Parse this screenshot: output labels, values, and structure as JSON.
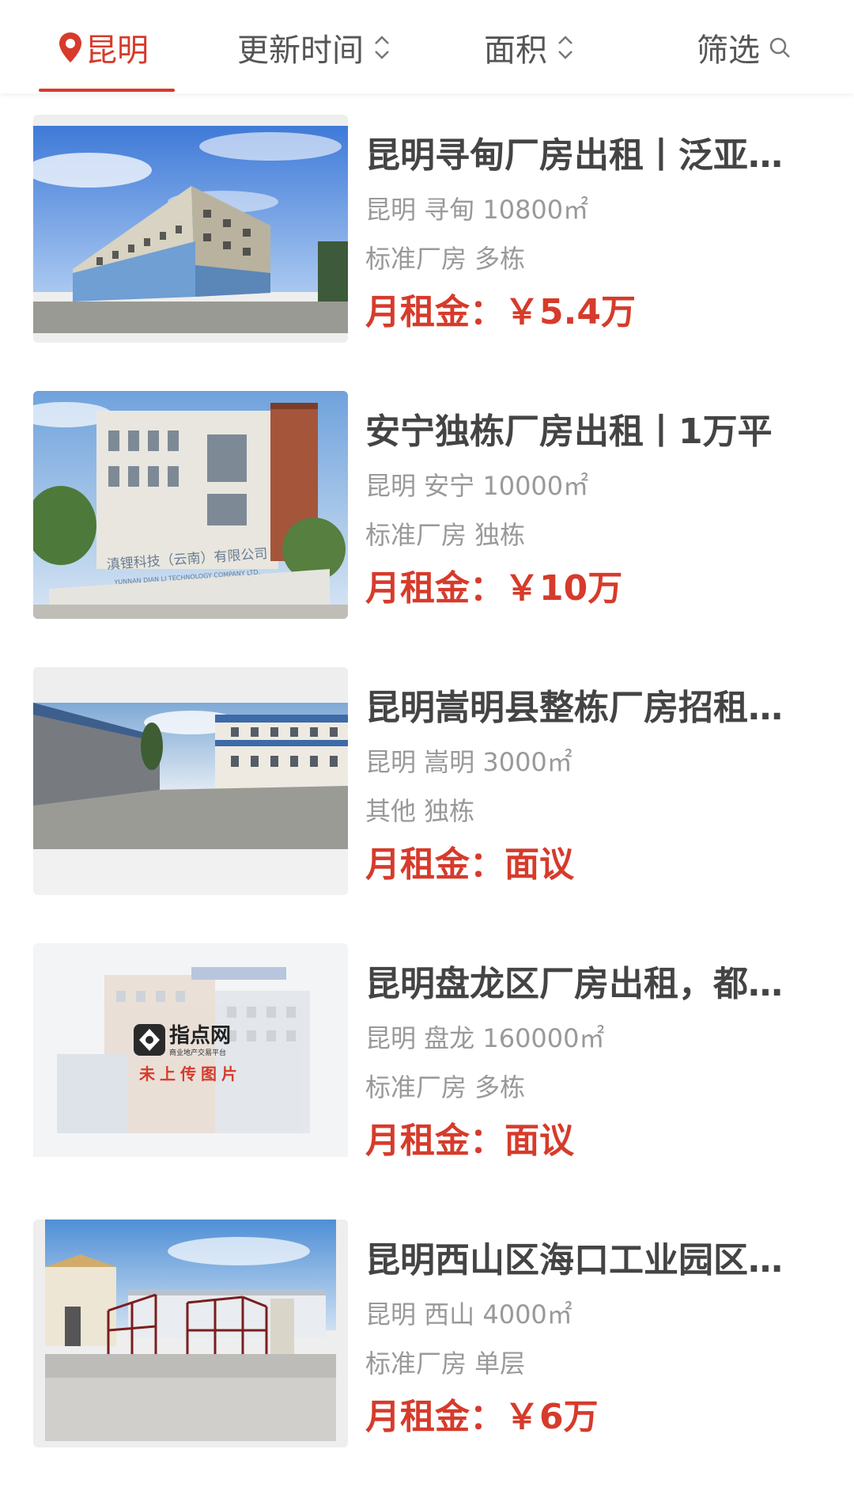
{
  "filter_bar": {
    "city": "昆明",
    "update_time": "更新时间",
    "area": "面积",
    "filter": "筛选"
  },
  "listings": [
    {
      "title": "昆明寻甸厂房出租丨泛亚…",
      "location": "昆明 寻甸 10800㎡",
      "category": "标准厂房 多栋",
      "rent": "月租金：￥5.4万"
    },
    {
      "title": "安宁独栋厂房出租丨1万平",
      "location": "昆明 安宁 10000㎡",
      "category": "标准厂房 独栋",
      "rent": "月租金：￥10万",
      "image_sign": {
        "cn": "滇锂科技（云南）有限公司",
        "en": "YUNNAN DIAN LI TECHNOLOGY COMPANY LTD."
      }
    },
    {
      "title": "昆明嵩明县整栋厂房招租…",
      "location": "昆明 嵩明 3000㎡",
      "category": "其他 独栋",
      "rent": "月租金：面议"
    },
    {
      "title": "昆明盘龙区厂房出租，都…",
      "location": "昆明 盘龙 160000㎡",
      "category": "标准厂房 多栋",
      "rent": "月租金：面议",
      "placeholder": {
        "brand": "指点网",
        "tagline": "商业地产交易平台",
        "notice": "未上传图片"
      }
    },
    {
      "title": "昆明西山区海口工业园区…",
      "location": "昆明 西山 4000㎡",
      "category": "标准厂房 单层",
      "rent": "月租金：￥6万"
    }
  ],
  "colors": {
    "accent": "#d63b2b",
    "title": "#444444",
    "meta": "#999999"
  },
  "icons": [
    "location-pin-icon",
    "sort-updown-icon",
    "search-icon"
  ]
}
